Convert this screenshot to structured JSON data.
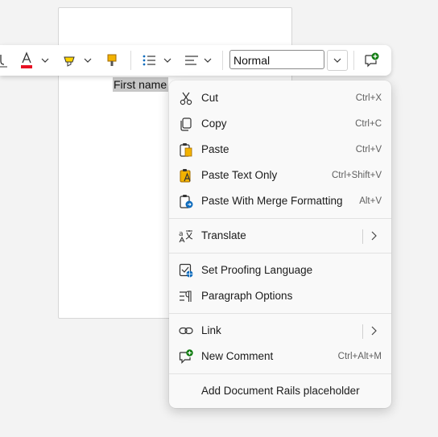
{
  "document": {
    "selected_text": "First name"
  },
  "toolbar": {
    "style_value": "Normal",
    "icons": [
      "underline-icon",
      "font-color-icon",
      "highlight-icon",
      "format-painter-icon",
      "bullets-icon",
      "align-icon",
      "new-comment-icon"
    ],
    "font_color": "#e81123",
    "highlight_color": "#ffd400",
    "accent_color": "#107c10"
  },
  "menu": {
    "cut": {
      "label": "Cut",
      "shortcut": "Ctrl+X"
    },
    "copy": {
      "label": "Copy",
      "shortcut": "Ctrl+C"
    },
    "paste": {
      "label": "Paste",
      "shortcut": "Ctrl+V"
    },
    "paste_text_only": {
      "label": "Paste Text Only",
      "shortcut": "Ctrl+Shift+V"
    },
    "paste_merge": {
      "label": "Paste With Merge Formatting",
      "shortcut": "Alt+V"
    },
    "translate": {
      "label": "Translate"
    },
    "set_proofing": {
      "label": "Set Proofing Language"
    },
    "paragraph_options": {
      "label": "Paragraph Options"
    },
    "link": {
      "label": "Link"
    },
    "new_comment": {
      "label": "New Comment",
      "shortcut": "Ctrl+Alt+M"
    },
    "add_rails": {
      "label": "Add Document Rails placeholder"
    }
  }
}
